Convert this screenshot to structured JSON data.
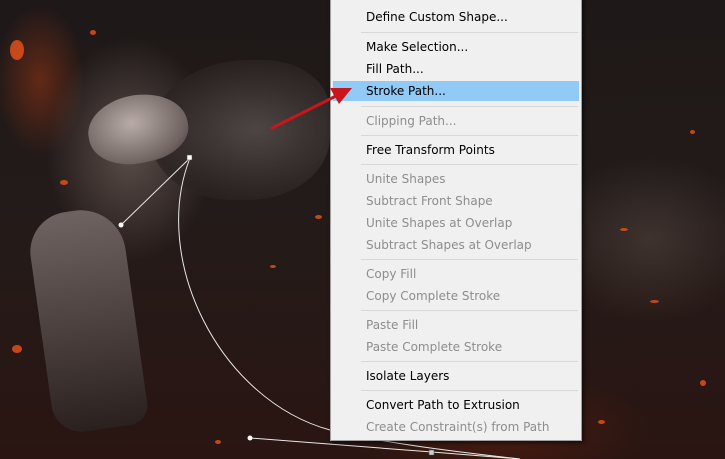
{
  "canvas": {
    "description_icon": "photoshop-artwork-canvas"
  },
  "context_menu": {
    "items": [
      {
        "label": "Define Custom Shape...",
        "enabled": true
      },
      {
        "label": "Make Selection...",
        "enabled": true
      },
      {
        "label": "Fill Path...",
        "enabled": true
      },
      {
        "label": "Stroke Path...",
        "enabled": true,
        "highlighted": true
      },
      {
        "label": "Clipping Path...",
        "enabled": false
      },
      {
        "label": "Free Transform Points",
        "enabled": true
      },
      {
        "label": "Unite Shapes",
        "enabled": false
      },
      {
        "label": "Subtract Front Shape",
        "enabled": false
      },
      {
        "label": "Unite Shapes at Overlap",
        "enabled": false
      },
      {
        "label": "Subtract Shapes at Overlap",
        "enabled": false
      },
      {
        "label": "Copy Fill",
        "enabled": false
      },
      {
        "label": "Copy Complete Stroke",
        "enabled": false
      },
      {
        "label": "Paste Fill",
        "enabled": false
      },
      {
        "label": "Paste Complete Stroke",
        "enabled": false
      },
      {
        "label": "Isolate Layers",
        "enabled": true
      },
      {
        "label": "Convert Path to Extrusion",
        "enabled": true
      },
      {
        "label": "Create Constraint(s) from Path",
        "enabled": false
      }
    ],
    "highlight_color": "#91c9f7"
  },
  "annotation": {
    "arrow_color": "#c8161c",
    "arrow_icon": "red-pointer-arrow-icon"
  }
}
